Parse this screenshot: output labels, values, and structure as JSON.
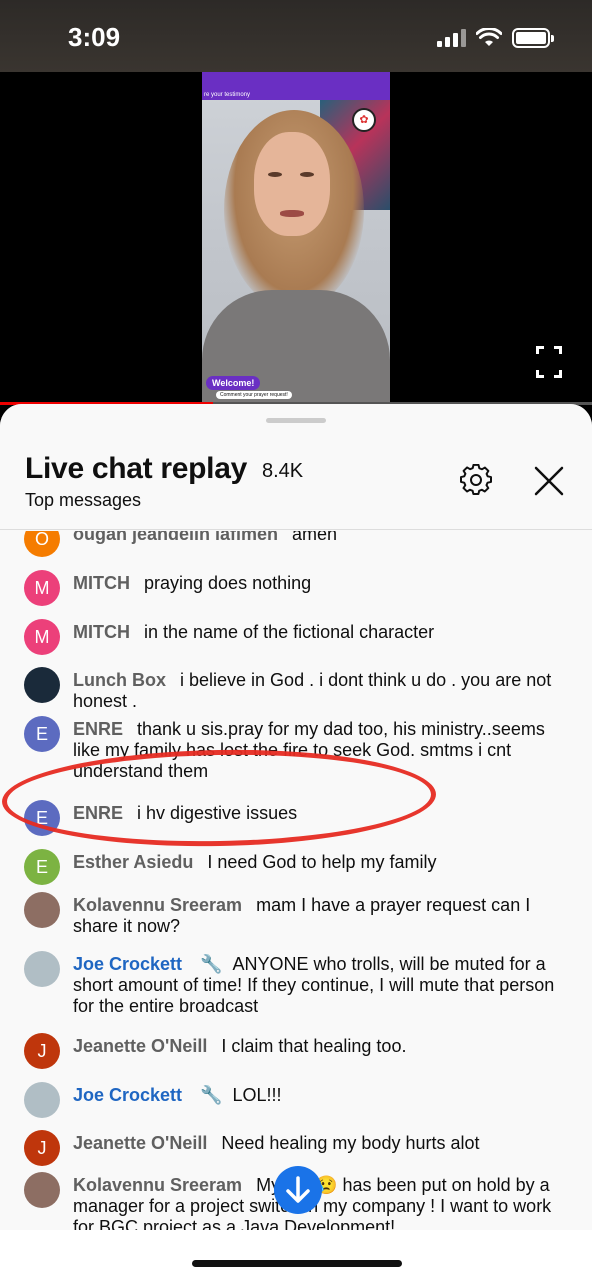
{
  "status": {
    "time": "3:09"
  },
  "video": {
    "caption": "re your testimony",
    "welcome": "Welcome!",
    "comment_prompt": "Comment your prayer request!",
    "progress": 0.36
  },
  "chat": {
    "title": "Live chat replay",
    "count": "8.4K",
    "filter": "Top messages",
    "messages": [
      {
        "avatar": "O",
        "author": "ougan jeandelin lafimen",
        "text": "amen",
        "color": "#f57c00"
      },
      {
        "avatar": "M",
        "author": "MITCH",
        "text": "praying does nothing",
        "color": "#ec407a"
      },
      {
        "avatar": "M",
        "author": "MITCH",
        "text": "in the name of the fictional character",
        "color": "#ec407a"
      },
      {
        "avatar": "",
        "author": "Lunch Box",
        "text": "i believe in God . i dont think u do . you are not honest .",
        "color": "#1a2a3a"
      },
      {
        "avatar": "E",
        "author": "ENRE",
        "text": "thank u sis.pray for my dad too, his ministry..seems like my family has lost the fire to seek God. smtms i cnt understand them",
        "color": "#5c6bc0"
      },
      {
        "avatar": "E",
        "author": "ENRE",
        "text": "i hv digestive issues",
        "color": "#5c6bc0"
      },
      {
        "avatar": "E",
        "author": "Esther Asiedu",
        "text": "I need God to help my family",
        "color": "#7cb342"
      },
      {
        "avatar": "",
        "author": "Kolavennu Sreeram",
        "text": "mam I have a prayer request can I share it now?",
        "color": "#8d6e63"
      },
      {
        "avatar": "",
        "author": "Joe Crockett",
        "text": "ANYONE who trolls, will be muted for a short amount of time! If they continue, I will mute that person for the entire broadcast",
        "color": "#b0bec5",
        "moderator": true
      },
      {
        "avatar": "J",
        "author": "Jeanette O'Neill",
        "text": "I claim that healing too.",
        "color": "#bf360c"
      },
      {
        "avatar": "",
        "author": "Joe Crockett",
        "text": "LOL!!!",
        "color": "#b0bec5",
        "moderator": true
      },
      {
        "avatar": "J",
        "author": "Jeanette O'Neill",
        "text": "Need healing my body hurts alot",
        "color": "#bf360c"
      },
      {
        "avatar": "",
        "author": "Kolavennu Sreeram",
        "text": "My CV 😢 has been put on hold by a manager for a project switch in my company ! I want to work for BGC project as a Java Development!",
        "color": "#8d6e63"
      }
    ]
  }
}
